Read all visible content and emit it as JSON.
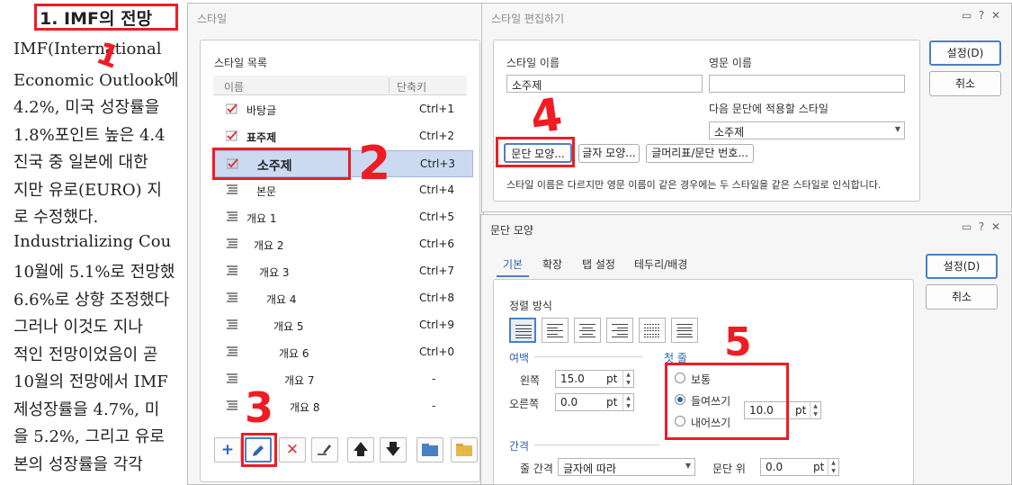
{
  "document": {
    "title": "1. IMF의 전망",
    "lines": [
      "IMF(International",
      "Economic Outlook에",
      "4.2%,  미국  성장률을",
      "1.8%포인트  높은  4.4",
      "진국 중 일본에 대한",
      "지만  유로(EURO)  지",
      "로      수정했다.",
      "Industrializing   Cou",
      "10월에  5.1%로  전망했",
      "6.6%로  상향  조정했다",
      "  그러나  이것도  지나",
      "적인  전망이었음이  곧",
      "10월의  전망에서  IMF",
      "제성장률을  4.7%,  미",
      "을  5.2%,  그리고  유로",
      "본의  성장률을  각각"
    ]
  },
  "style_dialog": {
    "title": "스타일",
    "list_label": "스타일 목록",
    "col_name": "이름",
    "col_shortcut": "단축키",
    "items": [
      {
        "name": "바탕글",
        "key": "Ctrl+1"
      },
      {
        "name": "표주제",
        "key": "Ctrl+2"
      },
      {
        "name": "소주제",
        "key": "Ctrl+3"
      },
      {
        "name": "본문",
        "key": "Ctrl+4"
      },
      {
        "name": "개요 1",
        "key": "Ctrl+5"
      },
      {
        "name": "개요 2",
        "key": "Ctrl+6"
      },
      {
        "name": "개요 3",
        "key": "Ctrl+7"
      },
      {
        "name": "개요 4",
        "key": "Ctrl+8"
      },
      {
        "name": "개요 5",
        "key": "Ctrl+9"
      },
      {
        "name": "개요 6",
        "key": "Ctrl+0"
      },
      {
        "name": "개요 7",
        "key": "-"
      },
      {
        "name": "개요 8",
        "key": "-"
      }
    ],
    "toolbar_icons": [
      "add-icon",
      "edit-pencil-icon",
      "delete-icon",
      "edit-style-icon",
      "move-up-icon",
      "move-down-icon",
      "import-icon",
      "open-folder-icon"
    ]
  },
  "edit_dialog": {
    "title": "스타일 편집하기",
    "style_name_label": "스타일 이름",
    "style_name_value": "소주제",
    "english_name_label": "영문 이름",
    "english_name_value": "",
    "next_style_label": "다음 문단에 적용할 스타일",
    "next_style_value": "소주제",
    "btn_paragraph": "문단 모양...",
    "btn_char": "글자 모양...",
    "btn_bullet": "글머리표/문단 번호...",
    "note": "스타일 이름은 다르지만 영문 이름이 같은 경우에는 두 스타일을 같은 스타일로 인식합니다.",
    "ok": "설정(D)",
    "cancel": "취소"
  },
  "para_dialog": {
    "title": "문단 모양",
    "tabs": [
      "기본",
      "확장",
      "탭 설정",
      "테두리/배경"
    ],
    "align_label": "정렬 방식",
    "margin_label": "여백",
    "left_label": "왼쪽",
    "left_value": "15.0",
    "right_label": "오른쪽",
    "right_value": "0.0",
    "unit": "pt",
    "first_line_label": "첫 줄",
    "opt_normal": "보통",
    "opt_indent": "들여쓰기",
    "opt_outdent": "내어쓰기",
    "indent_value": "10.0",
    "spacing_label": "간격",
    "line_spacing_label": "줄 간격",
    "line_spacing_value": "글자에 따라",
    "para_above_label": "문단 위",
    "para_above_value": "0.0",
    "ok": "설정(D)",
    "cancel": "취소"
  },
  "annotations": [
    "1",
    "2",
    "3",
    "4",
    "5"
  ],
  "colors": {
    "accent": "#4a7fc7",
    "annotation": "#ef1c24",
    "selection": "#cbd9f1"
  }
}
